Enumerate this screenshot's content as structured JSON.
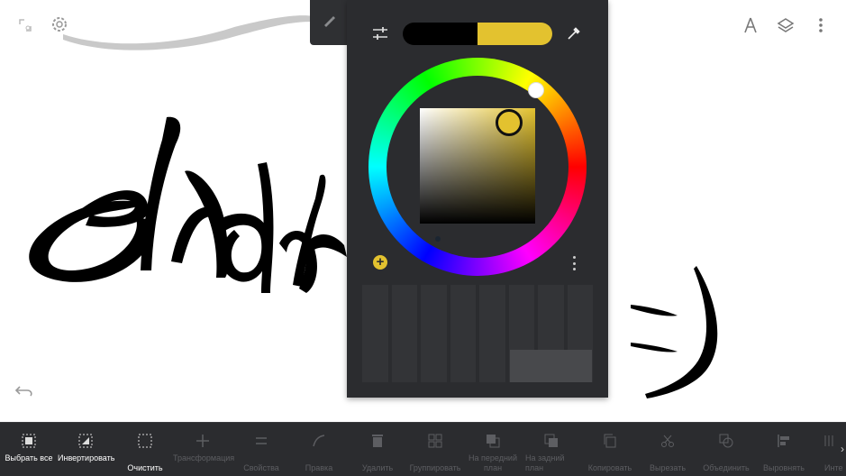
{
  "colors": {
    "panel_bg": "#2b2c2f",
    "accent_yellow": "#e3c22f",
    "current_swatch": "#000000",
    "previous_swatch": "#e3c22f",
    "toolbar_bg": "#2b2c2f"
  },
  "top_left_icons": [
    "transform-handle-icon",
    "settings-gear-icon"
  ],
  "top_right_icons": [
    "ruler-compass-icon",
    "layers-icon",
    "overflow-menu-icon"
  ],
  "color_panel": {
    "brush_tab_icon": "brush-icon",
    "sliders_icon": "sliders-icon",
    "eyedropper_icon": "eyedropper-icon",
    "selected_hue": "yellow",
    "add_label": "+",
    "palette_slots": 8
  },
  "undo_icon": "undo-icon",
  "toolbar": {
    "items": [
      {
        "label": "Выбрать все",
        "icon": "select-all-icon",
        "state": "active"
      },
      {
        "label": "Инвертировать",
        "icon": "invert-selection-icon",
        "state": "active"
      },
      {
        "label": "Очистить",
        "icon": "clear-selection-icon",
        "state": "active"
      },
      {
        "label": "Трансформация",
        "icon": "transform-icon",
        "state": "disabled"
      },
      {
        "label": "Свойства",
        "icon": "properties-icon",
        "state": "disabled"
      },
      {
        "label": "Правка",
        "icon": "edit-icon",
        "state": "disabled"
      },
      {
        "label": "Удалить",
        "icon": "trash-icon",
        "state": "disabled"
      },
      {
        "label": "Группировать",
        "icon": "group-icon",
        "state": "disabled"
      },
      {
        "label": "На передний план",
        "icon": "bring-front-icon",
        "state": "disabled"
      },
      {
        "label": "На задний план",
        "icon": "send-back-icon",
        "state": "disabled"
      },
      {
        "label": "Копировать",
        "icon": "copy-icon",
        "state": "disabled"
      },
      {
        "label": "Вырезать",
        "icon": "scissors-icon",
        "state": "disabled"
      },
      {
        "label": "Объединить",
        "icon": "merge-icon",
        "state": "disabled"
      },
      {
        "label": "Выровнять",
        "icon": "align-icon",
        "state": "disabled"
      },
      {
        "label": "Инте",
        "icon": "grid-icon",
        "state": "disabled"
      }
    ],
    "more_glyph": "›"
  }
}
